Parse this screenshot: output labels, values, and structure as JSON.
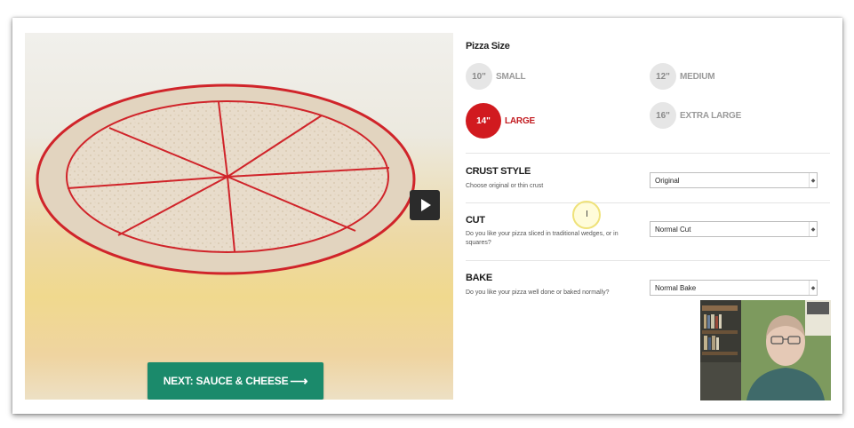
{
  "preview": {
    "next_button_label": "NEXT: SAUCE & CHEESE",
    "next_arrow": "⟶",
    "play_icon": "play-icon"
  },
  "pizza_size": {
    "title": "Pizza Size",
    "options": [
      {
        "size": "10\"",
        "label": "SMALL",
        "selected": false
      },
      {
        "size": "12\"",
        "label": "MEDIUM",
        "selected": false
      },
      {
        "size": "14\"",
        "label": "LARGE",
        "selected": true
      },
      {
        "size": "16\"",
        "label": "EXTRA LARGE",
        "selected": false
      }
    ]
  },
  "crust": {
    "title": "CRUST STYLE",
    "desc": "Choose original or thin crust",
    "value": "Original"
  },
  "cut": {
    "title": "CUT",
    "desc": "Do you like your pizza sliced in traditional wedges, or in squares?",
    "value": "Normal Cut"
  },
  "bake": {
    "title": "BAKE",
    "desc": "Do you like your pizza well done or baked normally?",
    "value": "Normal Bake"
  },
  "colors": {
    "accent_red": "#d11a1f",
    "button_green": "#1b8a6b",
    "pizza_outline": "#d0242a"
  }
}
